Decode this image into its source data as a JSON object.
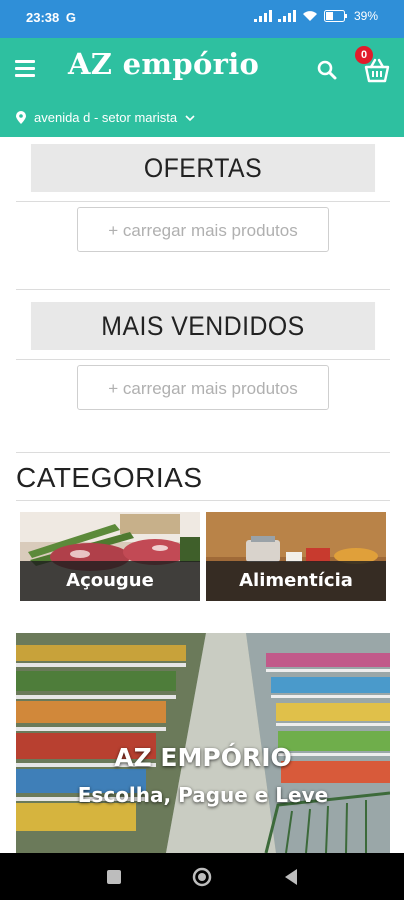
{
  "status_bar": {
    "time": "23:38",
    "carrier_glyph": "G",
    "battery": "39%"
  },
  "app_bar": {
    "title": "AZ empório",
    "cart_count": "0",
    "location": "avenida d - setor marista"
  },
  "sections": [
    {
      "header": "OFERTAS",
      "load_more": "+ carregar mais produtos"
    },
    {
      "header": "MAIS VENDIDOS",
      "load_more": "+ carregar mais produtos"
    }
  ],
  "categories": {
    "title": "CATEGORIAS",
    "items": [
      {
        "label": "Açougue"
      },
      {
        "label": "Alimentícia"
      }
    ]
  },
  "banner": {
    "title": "AZ EMPÓRIO",
    "subtitle": "Escolha, Pague e Leve"
  },
  "colors": {
    "status_bar": "#2f8fd8",
    "app_bar": "#2ec0a0",
    "badge": "#e21b2b"
  }
}
